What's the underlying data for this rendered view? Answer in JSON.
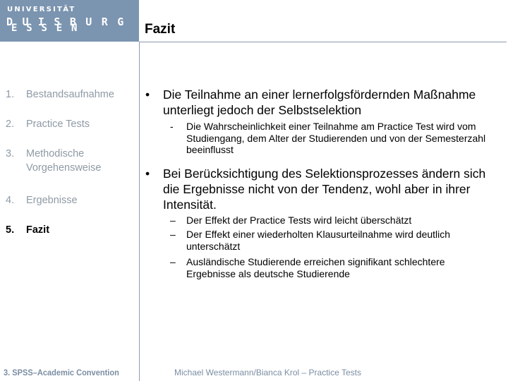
{
  "logo": {
    "top": "UNIVERSITÄT",
    "row1": "D U I S B U R G",
    "row2": "E S S E N"
  },
  "header": {
    "title": "Fazit"
  },
  "nav": {
    "items": [
      {
        "num": "1.",
        "label": "Bestandsaufnahme",
        "active": false
      },
      {
        "num": "2.",
        "label": "Practice Tests",
        "active": false
      },
      {
        "num": "3.",
        "label": "Methodische Vorgehensweise",
        "active": false
      },
      {
        "num": "4.",
        "label": "Ergebnisse",
        "active": false
      },
      {
        "num": "5.",
        "label": "Fazit",
        "active": true
      }
    ]
  },
  "content": {
    "bullets": [
      {
        "marker": "•",
        "text": "Die Teilnahme an einer lernerfolgsfördernden Maßnahme unterliegt jedoch der Selbstselektion",
        "sub": [
          {
            "marker": "-",
            "text": "Die Wahrscheinlichkeit einer Teilnahme am Practice Test wird vom Studiengang, dem Alter der Studierenden und von der Semesterzahl beeinflusst"
          }
        ]
      },
      {
        "marker": "•",
        "text": "Bei Berücksichtigung des Selektionsprozesses ändern sich die Ergebnisse nicht von der Tendenz, wohl aber in ihrer Intensität.",
        "sub": [
          {
            "marker": "–",
            "text": "Der Effekt der Practice Tests wird leicht überschätzt"
          },
          {
            "marker": "–",
            "text": "Der Effekt einer wiederholten Klausurteilnahme wird deutlich unterschätzt"
          },
          {
            "marker": "–",
            "text": "Ausländische Studierende erreichen signifikant schlechtere Ergebnisse als deutsche Studierende"
          }
        ]
      }
    ]
  },
  "footer": {
    "left": "3. SPSS–Academic Convention",
    "right": "Michael Westermann/Bianca Krol – Practice Tests"
  },
  "colors": {
    "brand": "#7b94b0",
    "nav_inactive": "#8f9aa5",
    "footer_text": "#7b8ea3"
  }
}
